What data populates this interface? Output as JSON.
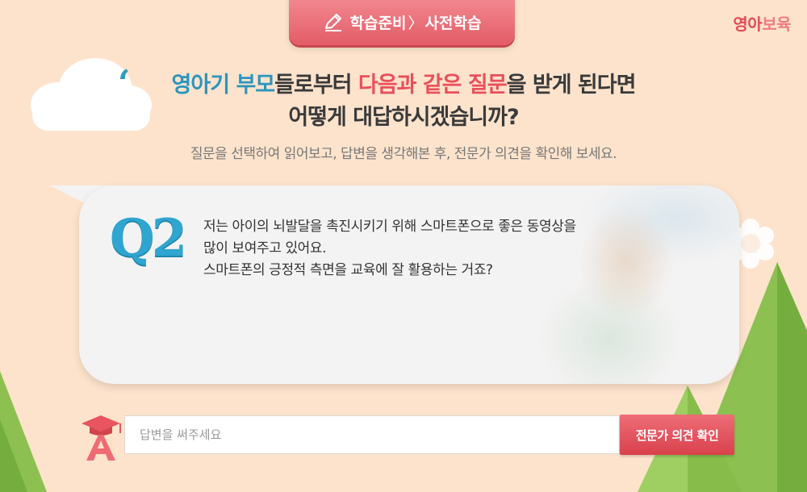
{
  "header": {
    "breadcrumb_part1": "학습준비",
    "breadcrumb_sep": "〉",
    "breadcrumb_part2": "사전학습",
    "brand_part1": "영아",
    "brand_part2": "보육"
  },
  "headline": {
    "line1_blue": "영아기 부모",
    "line1_plain1": "들로부터 ",
    "line1_red": "다음과 같은 질문",
    "line1_plain2": "을 받게 된다면",
    "line2": "어떻게 대답하시겠습니까?"
  },
  "instruction": "질문을 선택하여 읽어보고, 답변을 생각해본 후, 전문가 의견을 확인해 보세요.",
  "question": {
    "label": "Q2",
    "lines": [
      "저는 아이의 뇌발달을 촉진시키기 위해 스마트폰으로 좋은 동영상을",
      "많이 보여주고 있어요.",
      "스마트폰의 긍정적 측면을 교육에 잘 활용하는 거죠?"
    ]
  },
  "answer": {
    "placeholder": "답변을 써주세요",
    "value": "",
    "icon": "graduation-cap-letter-a-icon",
    "button_label": "전문가 의견 확인"
  },
  "colors": {
    "background": "#fde3cc",
    "accent_red": "#e35c66",
    "accent_blue": "#2b95bf",
    "tree_green": "#8cc152"
  }
}
